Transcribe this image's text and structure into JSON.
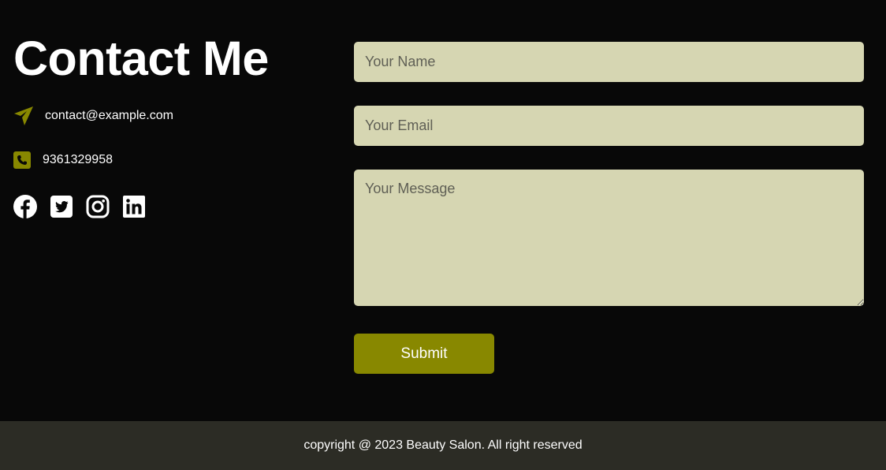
{
  "contact": {
    "title": "Contact Me",
    "email": "contact@example.com",
    "phone": "9361329958",
    "email_icon": "paper-plane-icon",
    "phone_icon": "phone-square-icon",
    "social": [
      "facebook-icon",
      "twitter-icon",
      "instagram-icon",
      "linkedin-icon"
    ]
  },
  "form": {
    "name_placeholder": "Your Name",
    "email_placeholder": "Your Email",
    "message_placeholder": "Your Message",
    "submit_label": "Submit"
  },
  "footer": {
    "text": "copyright @ 2023 Beauty Salon. All right reserved"
  },
  "colors": {
    "background": "#080808",
    "accent": "#888800",
    "field": "#d6d6b2",
    "footer": "#2c2c25"
  }
}
